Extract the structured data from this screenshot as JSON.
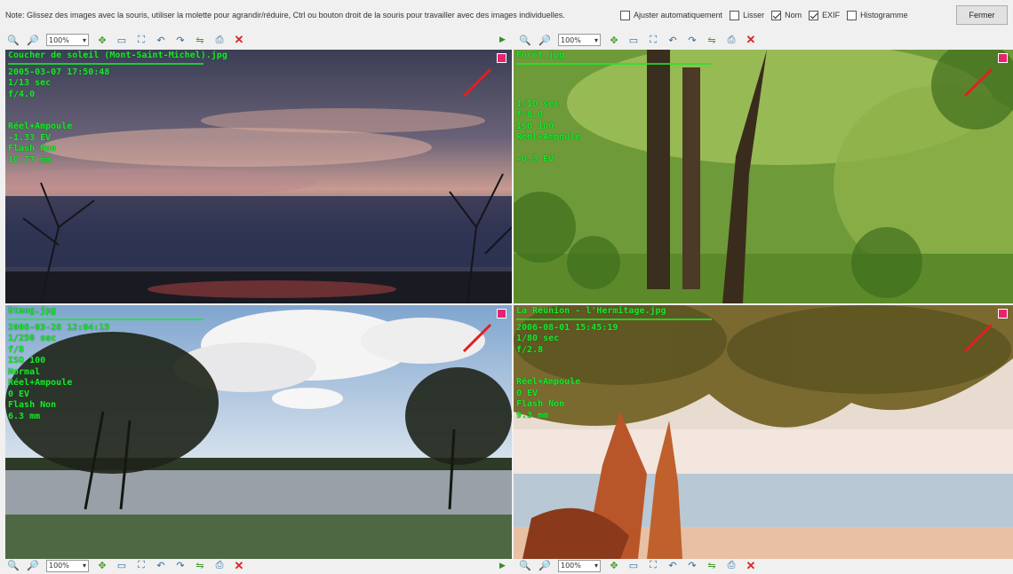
{
  "topbar": {
    "note": "Note: Glissez des images avec la souris, utiliser la molette pour agrandir/réduire, Ctrl ou bouton droit de la souris pour travailler avec des images individuelles.",
    "options": [
      {
        "label": "Ajuster automatiquement",
        "checked": false
      },
      {
        "label": "Lisser",
        "checked": false
      },
      {
        "label": "Nom",
        "checked": true
      },
      {
        "label": "EXIF",
        "checked": true
      },
      {
        "label": "Histogramme",
        "checked": false
      }
    ],
    "close_label": "Fermer"
  },
  "toolbar": {
    "zoom": "100%",
    "icons": [
      "zoom-in-icon",
      "zoom-out-icon",
      "fit-icon",
      "actual-size-icon",
      "fullscreen-icon",
      "rotate-left-icon",
      "rotate-right-icon",
      "flip-icon",
      "print-icon",
      "close-icon"
    ]
  },
  "panels": [
    {
      "name": "Coucher de soleil (Mont-Saint-Michel).jpg",
      "exif": [
        "2005-03-07 17:50:48",
        "1/13 sec",
        "f/4.0",
        "",
        "Réel+Ampoule",
        "-1.33 EV",
        "Flash Non",
        "10.77 mm"
      ]
    },
    {
      "name": "Forêt.jpg",
      "exif": [
        "",
        "",
        "",
        "1/10 sec",
        "f/8.0",
        "ISO 100",
        "Réel+Ampoule",
        "",
        "-0.3 EV"
      ]
    },
    {
      "name": "Etang.jpg",
      "exif": [
        "2006-03-28 12:04:15",
        "1/250 sec",
        "f/8",
        "ISO 100",
        "Normal",
        "Réel+Ampoule",
        "0 EV",
        "Flash Non",
        "6.3 mm"
      ]
    },
    {
      "name": "La Réunion - l'Hermitage.jpg",
      "exif": [
        "2006-08-01 15:45:19",
        "1/80 sec",
        "f/2.8",
        "",
        "",
        "Réel+Ampoule",
        "0 EV",
        "Flash Non",
        "9.3 mm"
      ]
    }
  ]
}
